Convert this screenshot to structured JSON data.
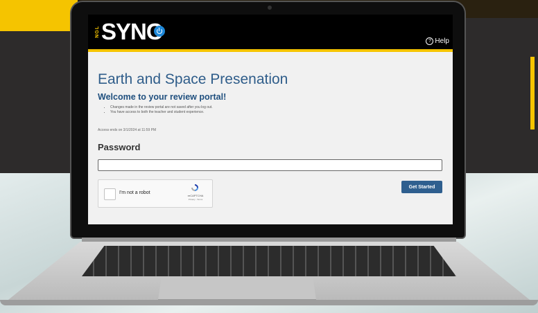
{
  "header": {
    "logo_prefix": "NGL",
    "logo_text": "SYNC",
    "help_label": "Help",
    "help_icon": "question-circle-icon"
  },
  "page": {
    "title": "Earth and Space Presenation",
    "welcome": "Welcome to your review portal!",
    "bullets": [
      "Changes made in the review portal are not saved after you log out.",
      "You have access to both the teacher and student experience."
    ],
    "access_note": "Access ends on 3/1/2024 at 11:59 PM"
  },
  "password": {
    "label": "Password",
    "value": "",
    "placeholder": ""
  },
  "captcha": {
    "label": "I'm not a robot",
    "brand": "reCAPTCHA",
    "terms": "Privacy - Terms"
  },
  "actions": {
    "submit_label": "Get Started"
  },
  "colors": {
    "accent_yellow": "#f5c400",
    "primary_blue": "#2f5f8f",
    "title_blue": "#2f5d8a"
  }
}
